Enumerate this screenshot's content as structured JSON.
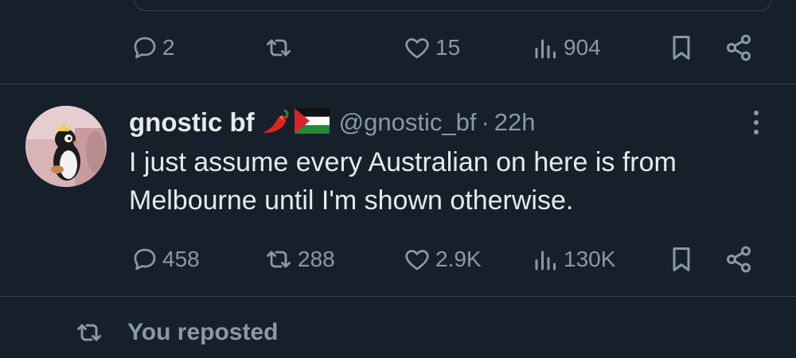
{
  "top_actions": {
    "replies": "2",
    "reposts": "",
    "likes": "15",
    "views": "904"
  },
  "tweet": {
    "display_name": "gnostic bf",
    "handle": "@gnostic_bf",
    "separator": "·",
    "time": "22h",
    "text": "I just assume every Australian on here is from Melbourne until I'm shown otherwise.",
    "replies": "458",
    "reposts": "288",
    "likes": "2.9K",
    "views": "130K"
  },
  "footer": {
    "reposted_label": "You reposted"
  },
  "icons": {
    "reply": "reply-icon",
    "repost": "repost-icon",
    "like": "heart-icon",
    "views": "views-icon",
    "bookmark": "bookmark-icon",
    "share": "share-icon",
    "more": "more-icon",
    "name_emoji": [
      "chili-pepper-emoji",
      "palestine-flag-emoji"
    ]
  },
  "colors": {
    "background": "#15202b",
    "text_primary": "#e7e9ea",
    "text_secondary": "#8b98a5",
    "divider": "#38444d"
  }
}
